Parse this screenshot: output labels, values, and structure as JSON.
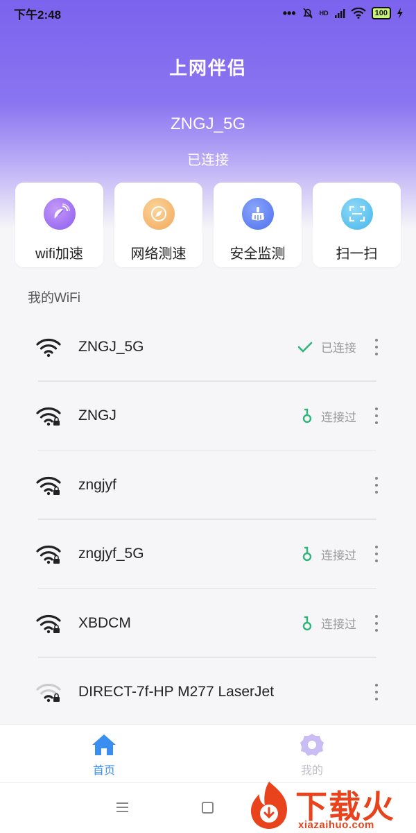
{
  "status_bar": {
    "time": "下午2:48",
    "signal_label": "HD",
    "battery": "100"
  },
  "header": {
    "app_title": "上网伴侣",
    "current_ssid": "ZNGJ_5G",
    "connection_status": "已连接"
  },
  "actions": [
    {
      "label": "wifi加速",
      "icon": "satellite-dish-icon",
      "color": "#9b6cf2"
    },
    {
      "label": "网络测速",
      "icon": "compass-icon",
      "color": "#f5b86a"
    },
    {
      "label": "安全监测",
      "icon": "broom-icon",
      "color": "#5a7ef5"
    },
    {
      "label": "扫一扫",
      "icon": "scan-icon",
      "color": "#55c0ee"
    }
  ],
  "section_title": "我的WiFi",
  "wifi_list": [
    {
      "name": "ZNGJ_5G",
      "status": "已连接",
      "status_icon": "check-icon",
      "locked": false,
      "weak": false
    },
    {
      "name": "ZNGJ",
      "status": "连接过",
      "status_icon": "key-icon",
      "locked": true,
      "weak": false
    },
    {
      "name": "zngjyf",
      "status": "",
      "status_icon": "",
      "locked": true,
      "weak": false
    },
    {
      "name": "zngjyf_5G",
      "status": "连接过",
      "status_icon": "key-icon",
      "locked": true,
      "weak": false
    },
    {
      "name": "XBDCM",
      "status": "连接过",
      "status_icon": "key-icon",
      "locked": true,
      "weak": false
    },
    {
      "name": "DIRECT-7f-HP M277 LaserJet",
      "status": "",
      "status_icon": "",
      "locked": true,
      "weak": true
    }
  ],
  "tabs": [
    {
      "label": "首页",
      "icon": "home-icon",
      "active": true
    },
    {
      "label": "我的",
      "icon": "gear-icon",
      "active": false
    }
  ],
  "watermark": {
    "brand": "下载火",
    "domain": "xiazaihuo.com"
  },
  "colors": {
    "accent": "#7b63ee",
    "tab_active": "#3a8ef0",
    "tab_inactive": "#c0c0c8",
    "status_green": "#2fb57a"
  }
}
